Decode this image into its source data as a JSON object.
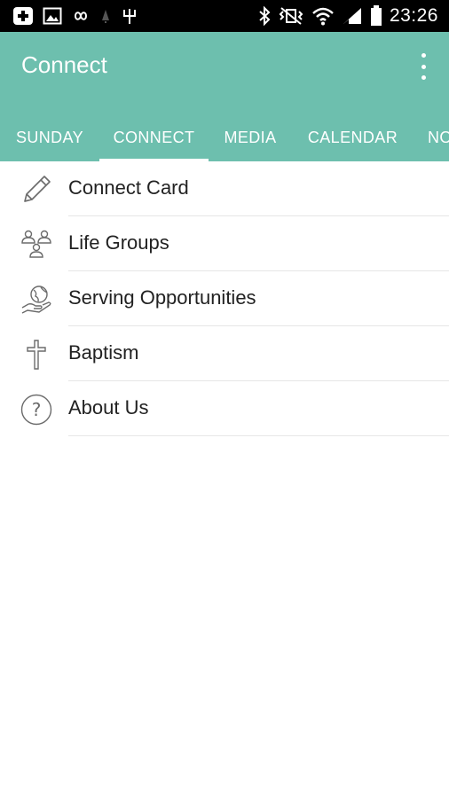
{
  "status_bar": {
    "time": "23:26",
    "left_icons": [
      "add-box-icon",
      "image-icon",
      "infinity-icon",
      "notification-icon",
      "usb-icon"
    ],
    "right_icons": [
      "bluetooth-icon",
      "vibrate-mute-icon",
      "wifi-icon",
      "signal-icon",
      "battery-icon"
    ]
  },
  "app_bar": {
    "title": "Connect",
    "color": "#6dbfae",
    "overflow_icon": "more-vert-icon"
  },
  "tabs": [
    {
      "label": "SUNDAY",
      "active": false
    },
    {
      "label": "CONNECT",
      "active": true
    },
    {
      "label": "MEDIA",
      "active": false
    },
    {
      "label": "CALENDAR",
      "active": false
    },
    {
      "label": "NO",
      "active": false
    }
  ],
  "list": {
    "items": [
      {
        "label": "Connect Card",
        "icon": "pencil-icon"
      },
      {
        "label": "Life Groups",
        "icon": "people-group-icon"
      },
      {
        "label": "Serving Opportunities",
        "icon": "hand-globe-icon"
      },
      {
        "label": "Baptism",
        "icon": "cross-icon"
      },
      {
        "label": "About Us",
        "icon": "question-circle-icon"
      }
    ]
  }
}
